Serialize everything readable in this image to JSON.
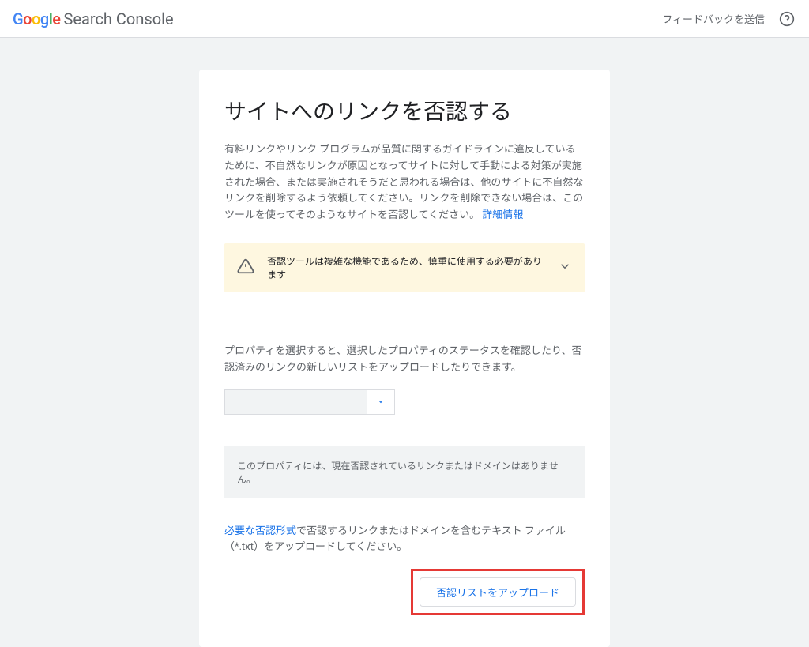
{
  "header": {
    "logo_text": "Search Console",
    "feedback": "フィードバックを送信"
  },
  "main": {
    "title": "サイトへのリンクを否認する",
    "description": "有料リンクやリンク プログラムが品質に関するガイドラインに違反しているために、不自然なリンクが原因となってサイトに対して手動による対策が実施された場合、または実施されそうだと思われる場合は、他のサイトに不自然なリンクを削除するよう依頼してください。リンクを削除できない場合は、このツールを使ってそのようなサイトを否認してください。",
    "learn_more": "詳細情報",
    "warning": "否認ツールは複雑な機能であるため、慎重に使用する必要があります",
    "property_section_text": "プロパティを選択すると、選択したプロパティのステータスを確認したり、否認済みのリンクの新しいリストをアップロードしたりできます。",
    "status_message": "このプロパティには、現在否認されているリンクまたはドメインはありません。",
    "format_link": "必要な否認形式",
    "upload_text": "で否認するリンクまたはドメインを含むテキスト ファイル（*.txt）をアップロードしてください。",
    "upload_button": "否認リストをアップロード"
  }
}
